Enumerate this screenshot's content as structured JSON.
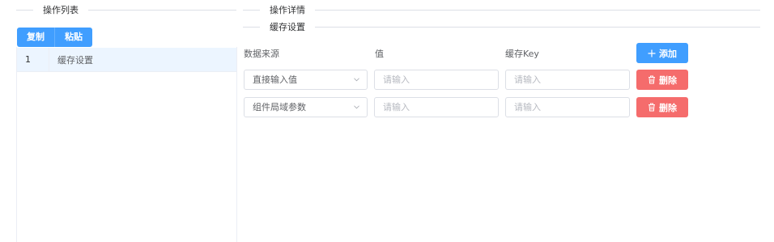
{
  "left": {
    "section_title": "操作列表",
    "copy_label": "复制",
    "paste_label": "粘贴",
    "items": [
      {
        "index": "1",
        "name": "缓存设置"
      }
    ]
  },
  "right": {
    "section_title": "操作详情",
    "sub_title": "缓存设置",
    "columns": {
      "source": "数据来源",
      "value": "值",
      "key": "缓存Key"
    },
    "add_label": "添加",
    "delete_label": "删除",
    "rows": [
      {
        "source": "直接输入值",
        "value_placeholder": "请输入",
        "key_placeholder": "请输入"
      },
      {
        "source": "组件局域参数",
        "value_placeholder": "请输入",
        "key_placeholder": "请输入"
      }
    ]
  },
  "colors": {
    "primary": "#409eff",
    "danger": "#f56c6c",
    "selected_row": "#ecf5ff",
    "border": "#dcdfe6"
  },
  "icons": {
    "add": "plus-icon",
    "delete": "trash-icon",
    "select": "chevron-down-icon"
  }
}
